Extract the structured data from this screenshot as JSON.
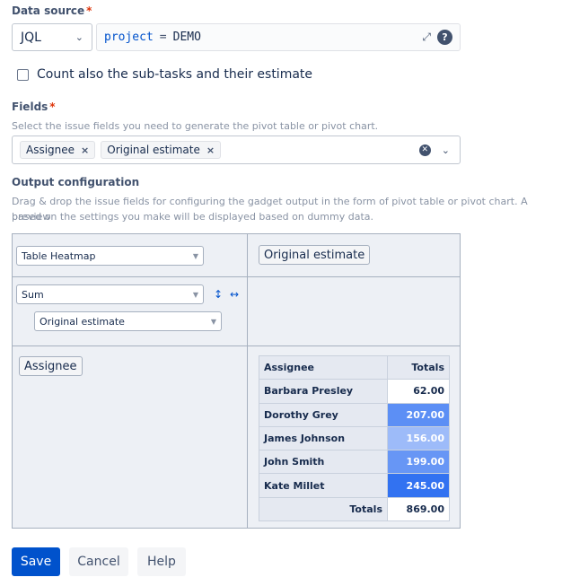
{
  "data_source": {
    "label": "Data source",
    "required_mark": "*",
    "type_value": "JQL",
    "query": {
      "field": "project",
      "operator": "=",
      "value": "DEMO"
    },
    "help_icon_text": "?"
  },
  "subtasks_checkbox": {
    "label": "Count also the sub-tasks and their estimate",
    "checked": false
  },
  "fields": {
    "label": "Fields",
    "required_mark": "*",
    "help": "Select the issue fields you need to generate the pivot table or pivot chart.",
    "tags": [
      {
        "label": "Assignee",
        "remove": "×"
      },
      {
        "label": "Original estimate",
        "remove": "×"
      }
    ]
  },
  "output": {
    "label": "Output configuration",
    "help_line1": "Drag & drop the issue fields for configuring the gadget output in the form of pivot table or pivot chart. A preview",
    "help_line2": "based on the settings you make will be displayed based on dummy data.",
    "renderer": "Table Heatmap",
    "aggregator": "Sum",
    "aggregator_field": "Original estimate",
    "column_attribute": "Original estimate",
    "row_attribute": "Assignee",
    "sort_icon": "↕",
    "swap_icon": "↔",
    "table": {
      "header": {
        "row_label": "Assignee",
        "totals_label": "Totals"
      },
      "rows": [
        {
          "name": "Barbara Presley",
          "value": "62.00",
          "color": "#ffffff",
          "text_color": "#172b4d"
        },
        {
          "name": "Dorothy Grey",
          "value": "207.00",
          "color": "#5c8ff5",
          "text_color": "#ffffff"
        },
        {
          "name": "James Johnson",
          "value": "156.00",
          "color": "#9dbbf9",
          "text_color": "#ffffff"
        },
        {
          "name": "John Smith",
          "value": "199.00",
          "color": "#6796f5",
          "text_color": "#ffffff"
        },
        {
          "name": "Kate Millet",
          "value": "245.00",
          "color": "#3272f1",
          "text_color": "#ffffff"
        }
      ],
      "totals": {
        "label": "Totals",
        "value": "869.00"
      }
    }
  },
  "buttons": {
    "save": "Save",
    "cancel": "Cancel",
    "help": "Help"
  },
  "colors": {
    "primary": "#0052cc",
    "required": "#de350b"
  }
}
